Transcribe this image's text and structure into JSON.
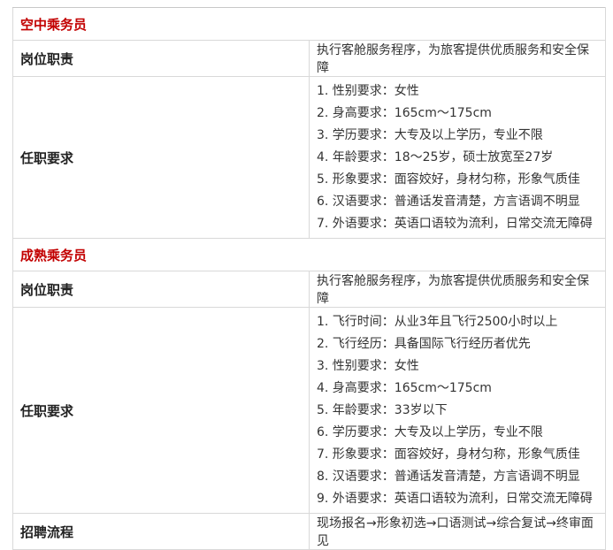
{
  "sections": [
    {
      "title": "空中乘务员",
      "duty_label": "岗位职责",
      "duty_text": "执行客舱服务程序，为旅客提供优质服务和安全保障",
      "req_label": "任职要求",
      "requirements": [
        "1. 性别要求：女性",
        "2. 身高要求：165cm～175cm",
        "3. 学历要求：大专及以上学历，专业不限",
        "4. 年龄要求：18～25岁，硕士放宽至27岁",
        "5. 形象要求：面容姣好，身材匀称，形象气质佳",
        "6. 汉语要求：普通话发音清楚，方言语调不明显",
        "7. 外语要求：英语口语较为流利，日常交流无障碍"
      ]
    },
    {
      "title": "成熟乘务员",
      "duty_label": "岗位职责",
      "duty_text": "执行客舱服务程序，为旅客提供优质服务和安全保障",
      "req_label": "任职要求",
      "requirements": [
        "1. 飞行时间：从业3年且飞行2500小时以上",
        "2. 飞行经历：具备国际飞行经历者优先",
        "3. 性别要求：女性",
        "4. 身高要求：165cm～175cm",
        "5. 年龄要求：33岁以下",
        "6. 学历要求：大专及以上学历，专业不限",
        "7. 形象要求：面容姣好，身材匀称，形象气质佳",
        "8. 汉语要求：普通话发音清楚，方言语调不明显",
        "9. 外语要求：英语口语较为流利，日常交流无障碍"
      ]
    }
  ],
  "process": {
    "label": "招聘流程",
    "text": "现场报名→形象初选→口语测试→综合复试→终审面见"
  },
  "colors": {
    "section_title": "#c20000",
    "border": "#d9d9d9",
    "text": "#333333"
  }
}
